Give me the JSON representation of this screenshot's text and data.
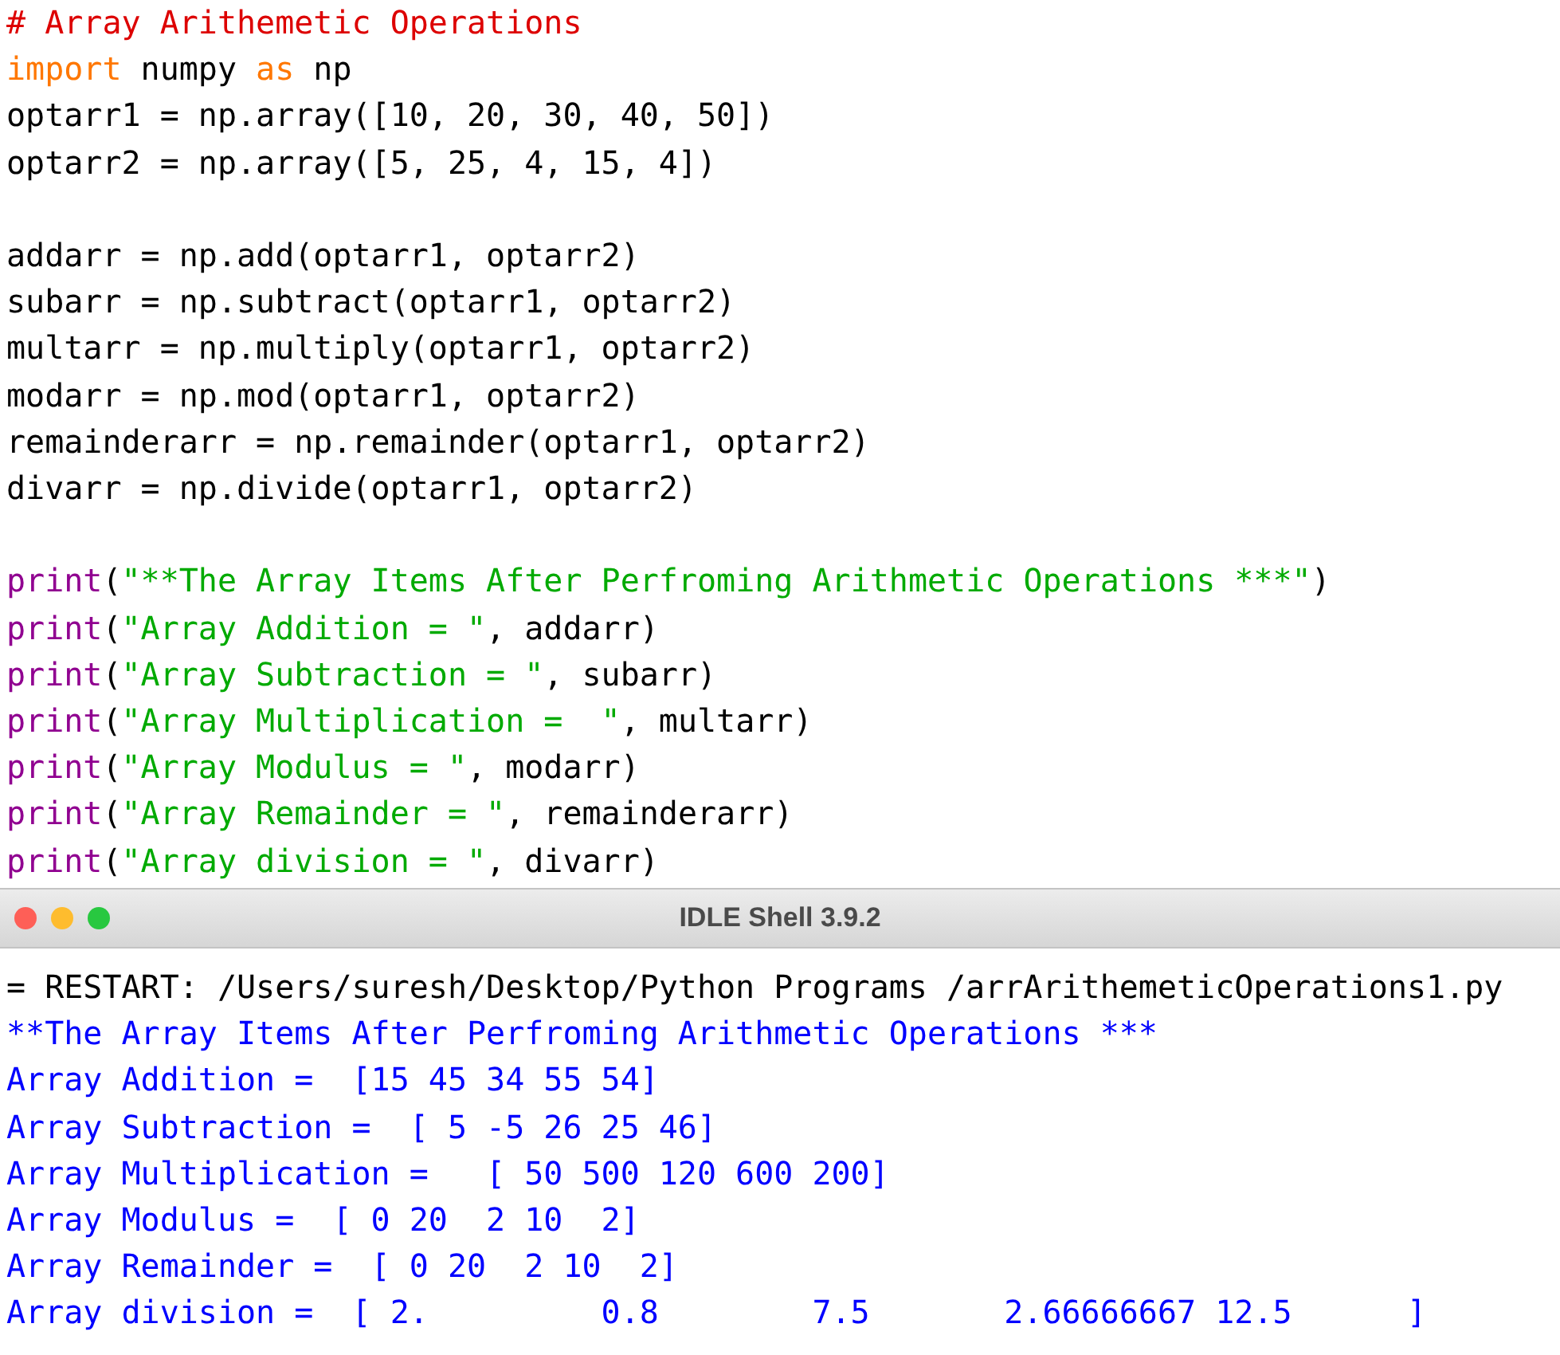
{
  "editor": {
    "lines": [
      {
        "kind": "code",
        "tokens": [
          {
            "text": "# Array Arithemetic Operations",
            "kind": "comment"
          }
        ]
      },
      {
        "kind": "code",
        "tokens": [
          {
            "text": "import",
            "kind": "keyword"
          },
          {
            "text": " numpy ",
            "kind": "plain"
          },
          {
            "text": "as",
            "kind": "keyword"
          },
          {
            "text": " np",
            "kind": "plain"
          }
        ]
      },
      {
        "kind": "code",
        "tokens": [
          {
            "text": "optarr1 = np.array([10, 20, 30, 40, 50])",
            "kind": "plain"
          }
        ]
      },
      {
        "kind": "code",
        "tokens": [
          {
            "text": "optarr2 = np.array([5, 25, 4, 15, 4])",
            "kind": "plain"
          }
        ]
      },
      {
        "kind": "blank"
      },
      {
        "kind": "code",
        "tokens": [
          {
            "text": "addarr = np.add(optarr1, optarr2)",
            "kind": "plain"
          }
        ]
      },
      {
        "kind": "code",
        "tokens": [
          {
            "text": "subarr = np.subtract(optarr1, optarr2)",
            "kind": "plain"
          }
        ]
      },
      {
        "kind": "code",
        "tokens": [
          {
            "text": "multarr = np.multiply(optarr1, optarr2)",
            "kind": "plain"
          }
        ]
      },
      {
        "kind": "code",
        "tokens": [
          {
            "text": "modarr = np.mod(optarr1, optarr2)",
            "kind": "plain"
          }
        ]
      },
      {
        "kind": "code",
        "tokens": [
          {
            "text": "remainderarr = np.remainder(optarr1, optarr2)",
            "kind": "plain"
          }
        ]
      },
      {
        "kind": "code",
        "tokens": [
          {
            "text": "divarr = np.divide(optarr1, optarr2)",
            "kind": "plain"
          }
        ]
      },
      {
        "kind": "blank"
      },
      {
        "kind": "code",
        "tokens": [
          {
            "text": "print",
            "kind": "builtin"
          },
          {
            "text": "(",
            "kind": "plain"
          },
          {
            "text": "\"**The Array Items After Perfroming Arithmetic Operations ***\"",
            "kind": "string"
          },
          {
            "text": ")",
            "kind": "plain"
          }
        ]
      },
      {
        "kind": "code",
        "tokens": [
          {
            "text": "print",
            "kind": "builtin"
          },
          {
            "text": "(",
            "kind": "plain"
          },
          {
            "text": "\"Array Addition = \"",
            "kind": "string"
          },
          {
            "text": ", addarr)",
            "kind": "plain"
          }
        ]
      },
      {
        "kind": "code",
        "tokens": [
          {
            "text": "print",
            "kind": "builtin"
          },
          {
            "text": "(",
            "kind": "plain"
          },
          {
            "text": "\"Array Subtraction = \"",
            "kind": "string"
          },
          {
            "text": ", subarr)",
            "kind": "plain"
          }
        ]
      },
      {
        "kind": "code",
        "tokens": [
          {
            "text": "print",
            "kind": "builtin"
          },
          {
            "text": "(",
            "kind": "plain"
          },
          {
            "text": "\"Array Multiplication =  \"",
            "kind": "string"
          },
          {
            "text": ", multarr)",
            "kind": "plain"
          }
        ]
      },
      {
        "kind": "code",
        "tokens": [
          {
            "text": "print",
            "kind": "builtin"
          },
          {
            "text": "(",
            "kind": "plain"
          },
          {
            "text": "\"Array Modulus = \"",
            "kind": "string"
          },
          {
            "text": ", modarr)",
            "kind": "plain"
          }
        ]
      },
      {
        "kind": "code",
        "tokens": [
          {
            "text": "print",
            "kind": "builtin"
          },
          {
            "text": "(",
            "kind": "plain"
          },
          {
            "text": "\"Array Remainder = \"",
            "kind": "string"
          },
          {
            "text": ", remainderarr)",
            "kind": "plain"
          }
        ]
      },
      {
        "kind": "code",
        "tokens": [
          {
            "text": "print",
            "kind": "builtin"
          },
          {
            "text": "(",
            "kind": "plain"
          },
          {
            "text": "\"Array division = \"",
            "kind": "string"
          },
          {
            "text": ", divarr)",
            "kind": "plain"
          }
        ]
      }
    ]
  },
  "shell": {
    "title": "IDLE Shell 3.9.2",
    "lines": [
      {
        "kind": "system",
        "text": "= RESTART: /Users/suresh/Desktop/Python Programs /arrArithemeticOperations1.py"
      },
      {
        "kind": "output",
        "text": "**The Array Items After Perfroming Arithmetic Operations ***"
      },
      {
        "kind": "output",
        "text": "Array Addition =  [15 45 34 55 54]"
      },
      {
        "kind": "output",
        "text": "Array Subtraction =  [ 5 -5 26 25 46]"
      },
      {
        "kind": "output",
        "text": "Array Multiplication =   [ 50 500 120 600 200]"
      },
      {
        "kind": "output",
        "text": "Array Modulus =  [ 0 20  2 10  2]"
      },
      {
        "kind": "output",
        "text": "Array Remainder =  [ 0 20  2 10  2]"
      },
      {
        "kind": "output",
        "text": "Array division =  [ 2.         0.8        7.5       2.66666667 12.5      ]"
      }
    ]
  }
}
